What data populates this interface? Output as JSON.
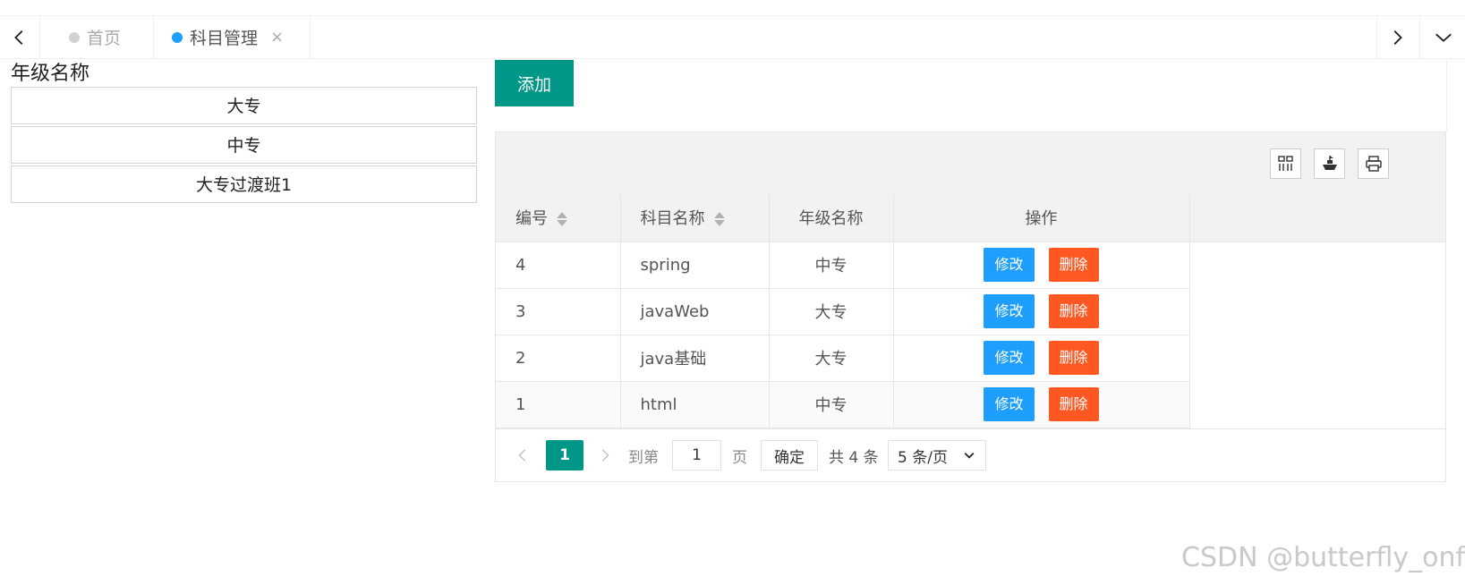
{
  "tabs": {
    "items": [
      {
        "label": "首页",
        "dot_color": "#d2d2d2"
      },
      {
        "label": "科目管理",
        "dot_color": "#1e9fff",
        "close": "×"
      }
    ]
  },
  "grades": {
    "title": "年级名称",
    "items": [
      "大专",
      "中专",
      "大专过渡班1"
    ]
  },
  "toolbar": {
    "add_label": "添加",
    "icons": [
      "columns-icon",
      "export-icon",
      "print-icon"
    ]
  },
  "table": {
    "headers": {
      "id": "编号",
      "name": "科目名称",
      "grade": "年级名称",
      "op": "操作"
    },
    "rows": [
      {
        "id": "4",
        "name": "spring",
        "grade": "中专"
      },
      {
        "id": "3",
        "name": "javaWeb",
        "grade": "大专"
      },
      {
        "id": "2",
        "name": "java基础",
        "grade": "大专"
      },
      {
        "id": "1",
        "name": "html",
        "grade": "中专"
      }
    ],
    "edit_label": "修改",
    "delete_label": "删除"
  },
  "pager": {
    "current": "1",
    "goto_label": "到第",
    "input_value": "1",
    "page_unit": "页",
    "confirm_label": "确定",
    "total": "共 4 条",
    "page_size": "5 条/页"
  },
  "colors": {
    "primary": "#009688",
    "edit": "#1e9fff",
    "delete": "#ff5722"
  },
  "watermark": "CSDN @butterfly_onfly"
}
